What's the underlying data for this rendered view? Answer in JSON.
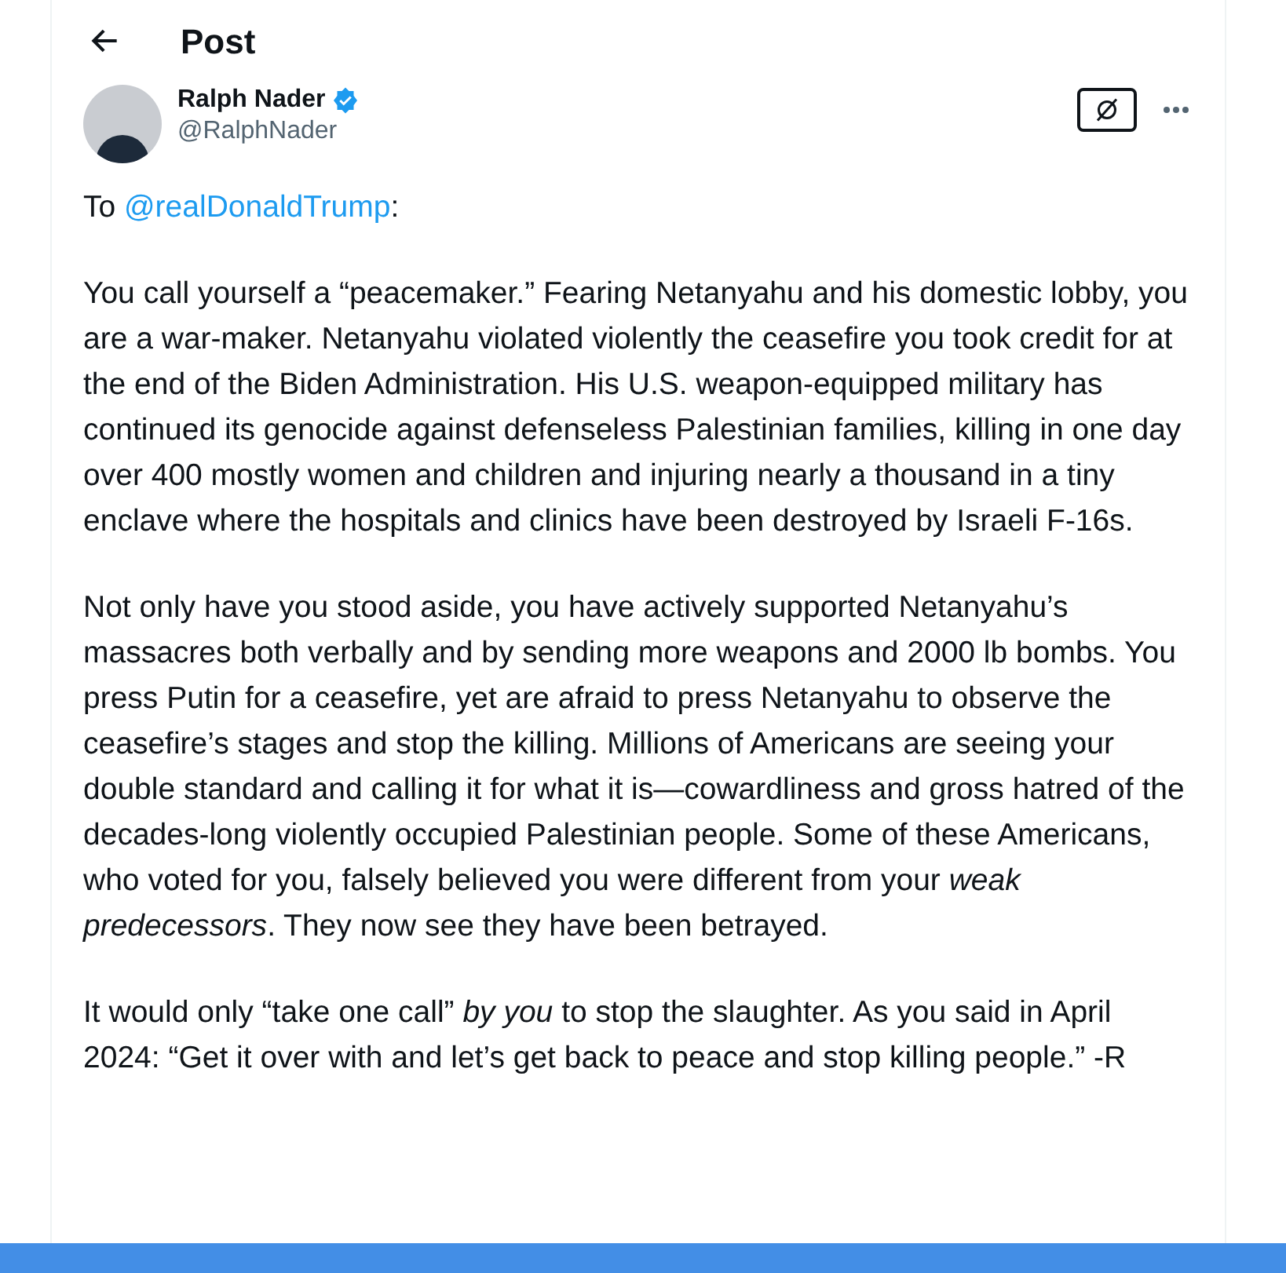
{
  "header": {
    "title": "Post"
  },
  "author": {
    "name": "Ralph Nader",
    "verified": true,
    "handle": "@RalphNader"
  },
  "post": {
    "paragraphs": [
      [
        {
          "kind": "text",
          "text": "To "
        },
        {
          "kind": "mention",
          "text": "@realDonaldTrump"
        },
        {
          "kind": "text",
          "text": ":"
        }
      ],
      [
        {
          "kind": "text",
          "text": "You call yourself a “peacemaker.” Fearing Netanyahu and his domestic lobby, you are a war-maker. Netanyahu violated violently the ceasefire you took credit for at the end of the Biden Administration. His U.S. weapon-equipped military has continued its genocide against defenseless Palestinian families, killing in one day over 400 mostly women and children and injuring nearly a thousand in a tiny enclave where the hospitals and clinics have been destroyed by Israeli F-16s."
        }
      ],
      [
        {
          "kind": "text",
          "text": "Not only have you stood aside, you have actively supported Netanyahu’s massacres both verbally and by sending more weapons and 2000 lb bombs. You press Putin for a ceasefire, yet are afraid to press Netanyahu to observe the ceasefire’s stages and stop the killing. Millions of Americans are seeing your double standard and calling it for what it is—cowardliness and gross hatred of the decades-long violently occupied Palestinian people. Some of these Americans, who voted for you, falsely believed you were different from your *weak predecessors*. They now see they have been betrayed."
        }
      ],
      [
        {
          "kind": "text",
          "text": "It would only “take one call” *by you* to stop the slaughter. As you said in April 2024: “Get it over with and let’s get back to peace and stop killing people.” -R"
        }
      ]
    ]
  }
}
